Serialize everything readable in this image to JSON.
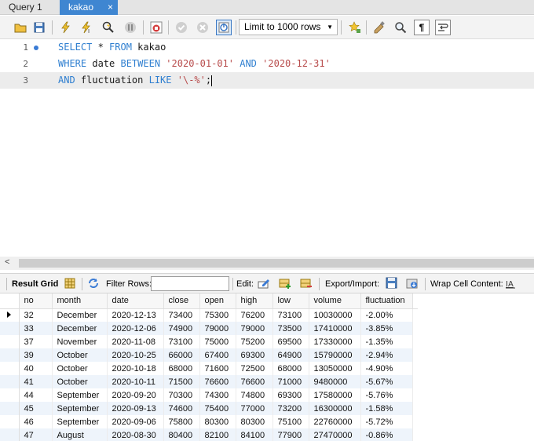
{
  "tabs": [
    {
      "label": "Query 1",
      "active": false
    },
    {
      "label": "kakao",
      "active": true,
      "close": "×"
    }
  ],
  "toolbar": {
    "limit_label": "Limit to 1000 rows",
    "icons": [
      "open-folder-icon",
      "save-icon",
      "execute-icon",
      "execute-current-icon",
      "explain-icon",
      "stop-icon",
      "toggle-stop-on-error-icon",
      "commit-icon",
      "rollback-icon",
      "autocommit-icon",
      "beautify-icon",
      "find-icon",
      "invisible-chars-icon",
      "wrap-icon"
    ]
  },
  "editor": {
    "lines": [
      {
        "num": "1",
        "tokens": [
          {
            "t": "SELECT",
            "c": "kw"
          },
          {
            "t": " * ",
            "c": "id"
          },
          {
            "t": "FROM",
            "c": "kw"
          },
          {
            "t": " kakao",
            "c": "id"
          }
        ]
      },
      {
        "num": "2",
        "tokens": [
          {
            "t": "WHERE",
            "c": "kw"
          },
          {
            "t": " date ",
            "c": "id"
          },
          {
            "t": "BETWEEN",
            "c": "kw"
          },
          {
            "t": " ",
            "c": "id"
          },
          {
            "t": "'2020-01-01'",
            "c": "str"
          },
          {
            "t": " ",
            "c": "id"
          },
          {
            "t": "AND",
            "c": "kw"
          },
          {
            "t": " ",
            "c": "id"
          },
          {
            "t": "'2020-12-31'",
            "c": "str"
          }
        ]
      },
      {
        "num": "3",
        "tokens": [
          {
            "t": "AND",
            "c": "kw"
          },
          {
            "t": " fluctuation ",
            "c": "id"
          },
          {
            "t": "LIKE",
            "c": "kw"
          },
          {
            "t": " ",
            "c": "id"
          },
          {
            "t": "'\\-%'",
            "c": "str"
          },
          {
            "t": ";",
            "c": "id"
          }
        ]
      }
    ]
  },
  "scrollbar": {
    "left_arrow": "<"
  },
  "result_toolbar": {
    "result_grid": "Result Grid",
    "filter_rows": "Filter Rows:",
    "edit": "Edit:",
    "export_import": "Export/Import:",
    "wrap_cell": "Wrap Cell Content:"
  },
  "grid": {
    "columns": [
      "no",
      "month",
      "date",
      "close",
      "open",
      "high",
      "low",
      "volume",
      "fluctuation"
    ],
    "rows": [
      [
        "32",
        "December",
        "2020-12-13",
        "73400",
        "75300",
        "76200",
        "73100",
        "10030000",
        "-2.00%"
      ],
      [
        "33",
        "December",
        "2020-12-06",
        "74900",
        "79000",
        "79000",
        "73500",
        "17410000",
        "-3.85%"
      ],
      [
        "37",
        "November",
        "2020-11-08",
        "73100",
        "75000",
        "75200",
        "69500",
        "17330000",
        "-1.35%"
      ],
      [
        "39",
        "October",
        "2020-10-25",
        "66000",
        "67400",
        "69300",
        "64900",
        "15790000",
        "-2.94%"
      ],
      [
        "40",
        "October",
        "2020-10-18",
        "68000",
        "71600",
        "72500",
        "68000",
        "13050000",
        "-4.90%"
      ],
      [
        "41",
        "October",
        "2020-10-11",
        "71500",
        "76600",
        "76600",
        "71000",
        "9480000",
        "-5.67%"
      ],
      [
        "44",
        "September",
        "2020-09-20",
        "70300",
        "74300",
        "74800",
        "69300",
        "17580000",
        "-5.76%"
      ],
      [
        "45",
        "September",
        "2020-09-13",
        "74600",
        "75400",
        "77000",
        "73200",
        "16300000",
        "-1.58%"
      ],
      [
        "46",
        "September",
        "2020-09-06",
        "75800",
        "80300",
        "80300",
        "75100",
        "22760000",
        "-5.72%"
      ],
      [
        "47",
        "August",
        "2020-08-30",
        "80400",
        "82100",
        "84100",
        "77900",
        "27470000",
        "-0.86%"
      ]
    ]
  }
}
